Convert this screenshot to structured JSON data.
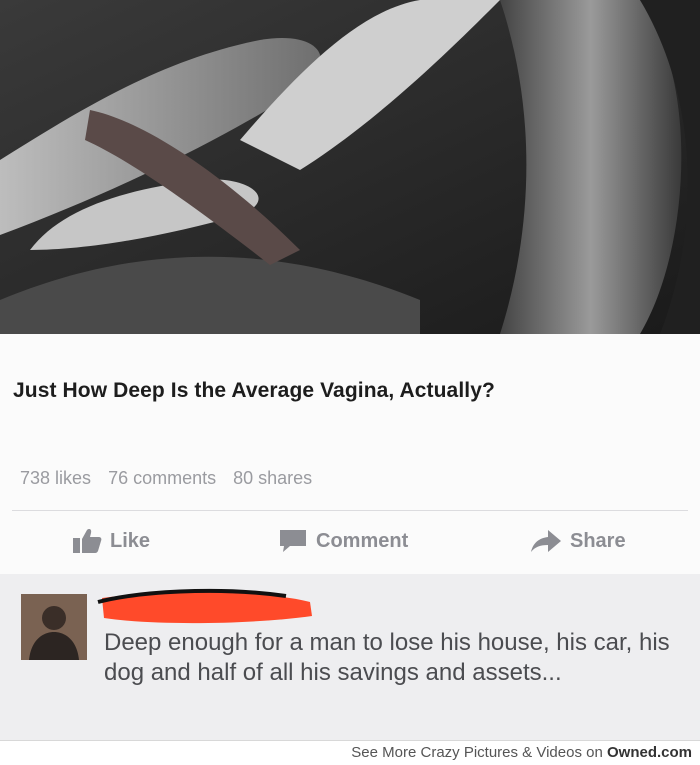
{
  "post": {
    "headline": "Just How Deep Is the Average Vagina, Actually?",
    "stats": {
      "likes": "738 likes",
      "comments": "76 comments",
      "shares": "80 shares"
    },
    "actions": {
      "like": "Like",
      "comment": "Comment",
      "share": "Share"
    }
  },
  "comment": {
    "text": "Deep enough for a man to lose his house, his car, his dog and half of all his savings and assets..."
  },
  "watermark": {
    "prefix": "See More Crazy Pictures & Videos on ",
    "site": "Owned.com"
  },
  "colors": {
    "redaction": "#ff4a2a",
    "action_gray": "#8c8d93"
  }
}
